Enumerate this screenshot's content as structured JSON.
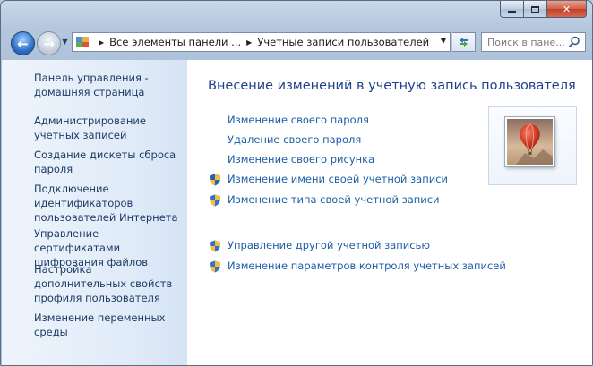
{
  "address_bar": {
    "crumbs": [
      "Все элементы панели ...",
      "Учетные записи пользователей"
    ]
  },
  "search": {
    "placeholder": "Поиск в пане..."
  },
  "sidebar": {
    "items": [
      {
        "label": "Панель управления - домашняя страница"
      },
      {
        "label": "Администрирование учетных записей"
      },
      {
        "label": "Создание дискеты сброса пароля"
      },
      {
        "label": "Подключение идентификаторов пользователей Интернета"
      },
      {
        "label": "Управление сертификатами шифрования файлов"
      },
      {
        "label": "Настройка дополнительных свойств профиля пользователя"
      },
      {
        "label": "Изменение переменных среды"
      }
    ]
  },
  "main": {
    "title": "Внесение изменений в учетную запись пользователя",
    "tasks": [
      {
        "label": "Изменение своего пароля",
        "shield": false
      },
      {
        "label": "Удаление своего пароля",
        "shield": false
      },
      {
        "label": "Изменение своего рисунка",
        "shield": false
      },
      {
        "label": "Изменение имени своей учетной записи",
        "shield": true
      },
      {
        "label": "Изменение типа своей учетной записи",
        "shield": true
      }
    ],
    "other_tasks": [
      {
        "label": "Управление другой учетной записью",
        "shield": true
      },
      {
        "label": "Изменение параметров контроля учетных записей",
        "shield": true
      }
    ]
  },
  "colors": {
    "link": "#1c5ea6",
    "title": "#1e3f8c",
    "sidebar_link": "#1e3a64"
  }
}
